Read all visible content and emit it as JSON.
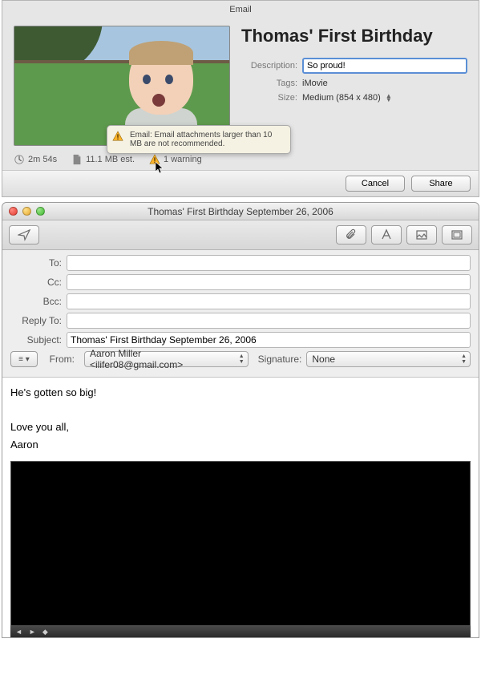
{
  "sheet": {
    "title": "Email",
    "movie_title": "Thomas' First Birthday",
    "labels": {
      "description": "Description:",
      "tags": "Tags:",
      "size": "Size:"
    },
    "description_value": "So proud!",
    "tags_value": "iMovie",
    "size_value": "Medium (854 x 480)",
    "status": {
      "duration": "2m 54s",
      "filesize": "11.1 MB est.",
      "warning_count": "1 warning",
      "warning_text": "Email: Email attachments larger than 10 MB are not recommended."
    },
    "buttons": {
      "cancel": "Cancel",
      "share": "Share"
    }
  },
  "mail": {
    "window_title": "Thomas' First Birthday September 26, 2006",
    "labels": {
      "to": "To:",
      "cc": "Cc:",
      "bcc": "Bcc:",
      "reply_to": "Reply To:",
      "subject": "Subject:",
      "from": "From:",
      "signature": "Signature:"
    },
    "fields": {
      "to": "",
      "cc": "",
      "bcc": "",
      "reply_to": "",
      "subject": "Thomas' First Birthday September 26, 2006"
    },
    "from_selected": "Aaron Miller <ilifer08@gmail.com>",
    "signature_selected": "None",
    "body_lines": [
      "He's gotten so big!",
      "",
      "Love you all,",
      "Aaron"
    ]
  }
}
